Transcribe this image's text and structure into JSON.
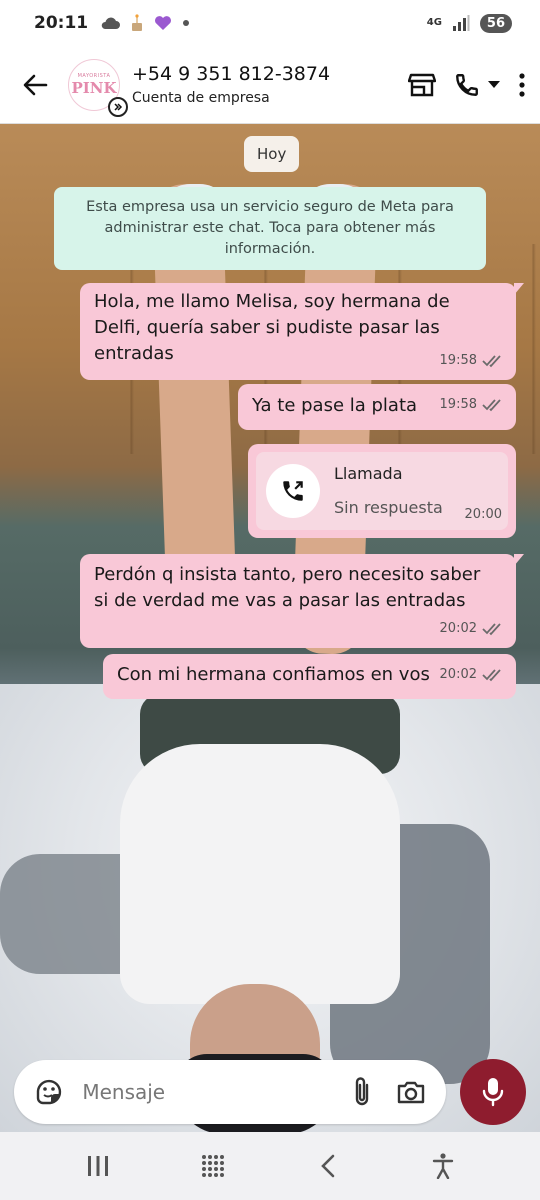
{
  "status_bar": {
    "time": "20:11",
    "network": "4G",
    "battery": "56"
  },
  "header": {
    "contact_name": "+54 9 351 812-3874",
    "subtitle": "Cuenta de empresa",
    "avatar_text_small": "MAYORISTA",
    "avatar_text_main": "PINK"
  },
  "chat": {
    "date_chip": "Hoy",
    "system_message": "Esta empresa usa un servicio seguro de Meta para administrar este chat. Toca para obtener más información.",
    "messages": [
      {
        "text": "Hola, me llamo Melisa, soy hermana de Delfi, quería saber si pudiste pasar las entradas",
        "time": "19:58"
      },
      {
        "text": "Ya te pase la plata",
        "time": "19:58"
      },
      {
        "call_title": "Llamada",
        "call_status": "Sin respuesta",
        "time": "20:00"
      },
      {
        "text": "Perdón q insista tanto, pero necesito saber si de verdad me vas a pasar las entradas",
        "time": "20:02"
      },
      {
        "text": "Con mi hermana confiamos en vos",
        "time": "20:02"
      }
    ]
  },
  "input": {
    "placeholder": "Mensaje"
  },
  "colors": {
    "bubble": "#f9c8d7",
    "system_bubble": "#d7f4ea",
    "mic_button": "#8e1c2e",
    "read_ticks": "#6b6b6b"
  },
  "icons": [
    "back-arrow-icon",
    "store-icon",
    "phone-icon",
    "dropdown-icon",
    "more-vert-icon",
    "sticker-icon",
    "attach-icon",
    "camera-icon",
    "mic-icon",
    "missed-call-icon",
    "double-check-icon",
    "recents-icon",
    "home-icon",
    "nav-back-icon",
    "accessibility-icon"
  ]
}
